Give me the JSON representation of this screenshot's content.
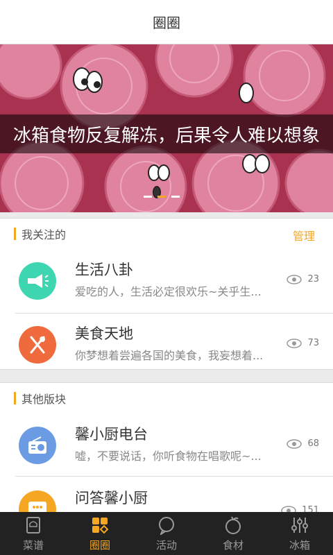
{
  "header": {
    "title": "圈圈"
  },
  "banner": {
    "caption": "冰箱食物反复解冻，后果令人难以想象",
    "dots": 3,
    "active_dot": 1
  },
  "followed": {
    "section_label": "我关注的",
    "manage_label": "管理",
    "items": [
      {
        "name": "生活八卦",
        "desc": "爱吃的人，生活必定很欢乐~关乎生...",
        "views": "23",
        "icon": "megaphone-icon",
        "color": "#3ed6b0"
      },
      {
        "name": "美食天地",
        "desc": "你梦想着尝遍各国的美食，我妄想着...",
        "views": "73",
        "icon": "fork-knife-icon",
        "color": "#ef6a3c"
      }
    ]
  },
  "others": {
    "section_label": "其他版块",
    "items": [
      {
        "name": "馨小厨电台",
        "desc": "嘘，不要说话，你听食物在唱歌呢~...",
        "views": "68",
        "icon": "radio-icon",
        "color": "#6a9be3"
      },
      {
        "name": "问答馨小厨",
        "desc": "",
        "views": "151",
        "icon": "chat-icon",
        "color": "#f5a623"
      }
    ]
  },
  "tabbar": {
    "items": [
      {
        "label": "菜谱",
        "icon": "recipe-icon"
      },
      {
        "label": "圈圈",
        "icon": "circles-icon"
      },
      {
        "label": "活动",
        "icon": "activity-icon"
      },
      {
        "label": "食材",
        "icon": "ingredients-icon"
      },
      {
        "label": "冰箱",
        "icon": "fridge-icon"
      }
    ],
    "active_index": 1
  }
}
